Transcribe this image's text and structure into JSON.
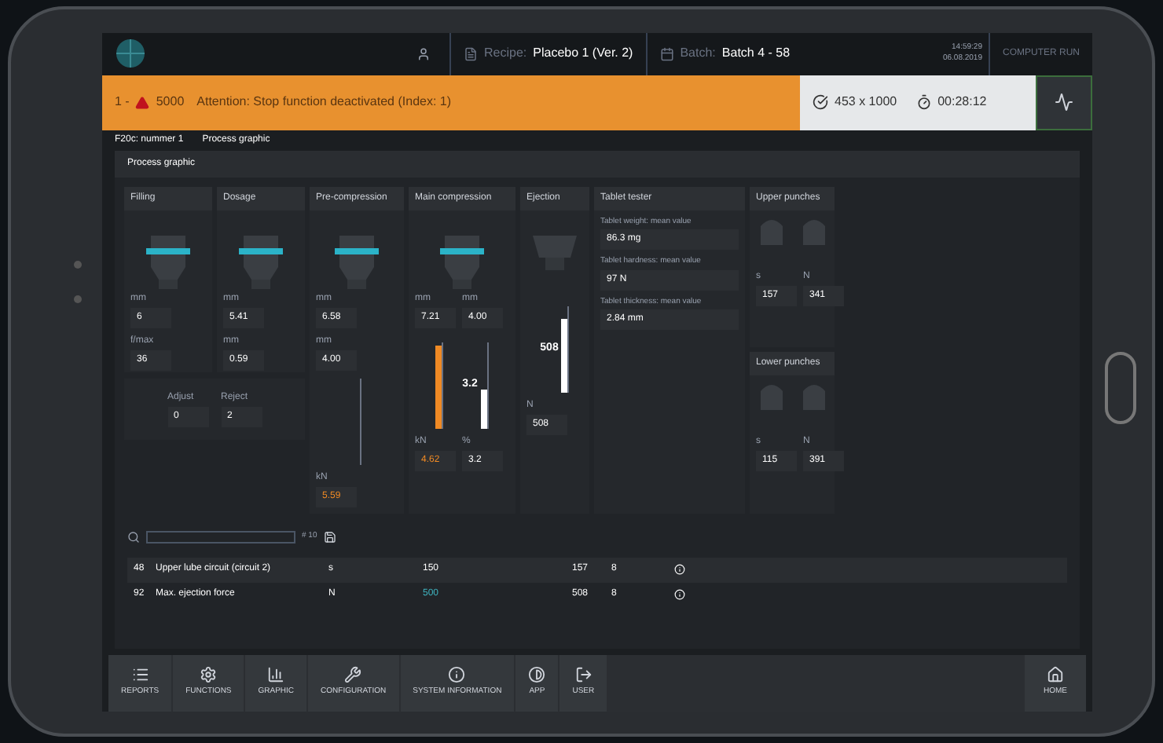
{
  "header": {
    "recipe_label": "Recipe:",
    "recipe": "Placebo 1 (Ver. 2)",
    "batch_label": "Batch:",
    "batch": "Batch 4 - 58",
    "time": "14:59:29",
    "date": "06.08.2019",
    "mode": "COMPUTER RUN"
  },
  "alarm": {
    "prefix": "1 -",
    "code": "5000",
    "message": "Attention: Stop function deactivated (Index: 1)",
    "count": "453 x 1000",
    "timer": "00:28:12"
  },
  "breadcrumb": [
    {
      "label": "F20c: nummer 1"
    },
    {
      "label": "Process graphic"
    }
  ],
  "panel_title": "Process graphic",
  "stations": [
    {
      "title": "Filling",
      "fields": [
        {
          "label": "mm",
          "value": "6",
          "warning": false
        },
        {
          "label": "f/max",
          "value": "36",
          "warning": false
        }
      ]
    },
    {
      "title": "Dosage",
      "fields": [
        {
          "label": "mm",
          "value": "5.41",
          "warning": false
        },
        {
          "label": "mm",
          "value": "0.59",
          "warning": false
        }
      ]
    },
    {
      "title": "Pre-compression",
      "fields": [
        {
          "label": "mm",
          "value": "6.58",
          "warning": false
        },
        {
          "label": "mm",
          "value": "4.00",
          "warning": false
        },
        {
          "label": "kN",
          "value": "5.59",
          "warning": true
        }
      ]
    },
    {
      "title": "Main compression",
      "fields": [
        {
          "label": "mm",
          "value": "7.21",
          "warning": false
        },
        {
          "label": "mm",
          "value": "4.00",
          "warning": false
        },
        {
          "label": "kN",
          "value": "4.62",
          "warning": true
        },
        {
          "label": "%",
          "value": "3.2",
          "warning": false
        }
      ],
      "gauges": [
        {
          "level": 0.95,
          "color": "#f08a24"
        },
        {
          "level": 0.45,
          "color": "#ffffff",
          "reading": "3.2"
        }
      ]
    },
    {
      "title": "Ejection",
      "fields": [
        {
          "label": "N",
          "value": "508",
          "warning": false
        }
      ],
      "gauges": [
        {
          "level": 0.85,
          "color": "#ffffff",
          "reading": "508"
        }
      ]
    }
  ],
  "adjust_reject": [
    {
      "label": "Adjust",
      "value": "0"
    },
    {
      "label": "Reject",
      "value": "2"
    }
  ],
  "tablet_tester": {
    "title": "Tablet tester",
    "items": [
      {
        "label": "Tablet weight: mean value",
        "value": "86.3 mg"
      },
      {
        "label": "Tablet hardness: mean value",
        "value": "97 N"
      },
      {
        "label": "Tablet thickness: mean value",
        "value": "2.84 mm"
      }
    ]
  },
  "punches": [
    {
      "title": "Upper punches",
      "fields": [
        {
          "label": "s",
          "value": "157"
        },
        {
          "label": "N",
          "value": "341"
        }
      ]
    },
    {
      "title": "Lower punches",
      "fields": [
        {
          "label": "s",
          "value": "115"
        },
        {
          "label": "N",
          "value": "391"
        }
      ]
    }
  ],
  "search": {
    "count": "# 10"
  },
  "table": {
    "rows": [
      {
        "id": "48",
        "name": "Upper lube circuit (circuit 2)",
        "unit": "s",
        "setpoint": "150",
        "setpoint_highlighted": false,
        "actual": "157",
        "column_5": "8"
      },
      {
        "id": "92",
        "name": "Max. ejection force",
        "unit": "N",
        "setpoint": "500",
        "setpoint_highlighted": true,
        "actual": "508",
        "column_5": "8"
      }
    ]
  },
  "nav": [
    {
      "label": "REPORTS"
    },
    {
      "label": "FUNCTIONS"
    },
    {
      "label": "GRAPHIC"
    },
    {
      "label": "CONFIGURATION"
    },
    {
      "label": "SYSTEM INFORMATION"
    },
    {
      "label": "APP"
    },
    {
      "label": "USER"
    }
  ],
  "home": {
    "label": "HOME"
  }
}
